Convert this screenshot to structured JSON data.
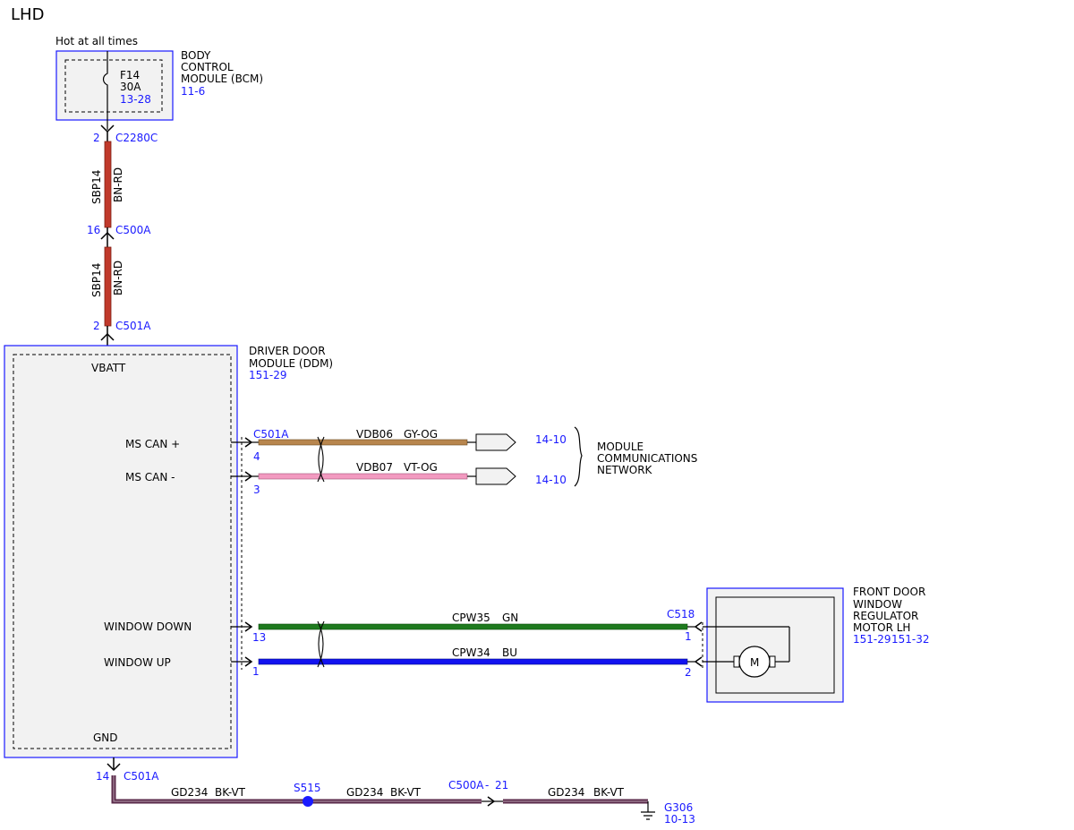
{
  "page": {
    "title": "LHD"
  },
  "bcm": {
    "feed_label": "Hot at all times",
    "name_line1": "BODY",
    "name_line2": "CONTROL",
    "name_line3": "MODULE (BCM)",
    "ref": "11-6",
    "fuse_name": "F14",
    "fuse_rating": "30A",
    "fuse_ref": "13-28"
  },
  "power_feed": {
    "conn1_pin": "2",
    "conn1_name": "C2280C",
    "seg1_circuit": "SBP14",
    "seg1_color": "BN-RD",
    "conn2_pin": "16",
    "conn2_name": "C500A",
    "seg2_circuit": "SBP14",
    "seg2_color": "BN-RD",
    "conn3_pin": "2",
    "conn3_name": "C501A"
  },
  "ddm": {
    "name_line1": "DRIVER DOOR",
    "name_line2": "MODULE (DDM)",
    "ref": "151-29",
    "vbatt": "VBATT",
    "gnd": "GND",
    "ms_can_plus": "MS CAN +",
    "ms_can_minus": "MS CAN -",
    "window_down": "WINDOW DOWN",
    "window_up": "WINDOW UP"
  },
  "can": {
    "connector": "C501A",
    "plus_pin": "4",
    "plus_circuit": "VDB06",
    "plus_color": "GY-OG",
    "plus_ref": "14-10",
    "minus_pin": "3",
    "minus_circuit": "VDB07",
    "minus_color": "VT-OG",
    "minus_ref": "14-10",
    "network_line1": "MODULE",
    "network_line2": "COMMUNICATIONS",
    "network_line3": "NETWORK"
  },
  "window": {
    "down_pin": "13",
    "down_circuit": "CPW35",
    "down_color": "GN",
    "up_pin": "1",
    "up_circuit": "CPW34",
    "up_color": "BU",
    "motor_connector": "C518",
    "motor_pin_down": "1",
    "motor_pin_up": "2",
    "motor_symbol": "M"
  },
  "motor": {
    "name_line1": "FRONT DOOR",
    "name_line2": "WINDOW",
    "name_line3": "REGULATOR",
    "name_line4": "MOTOR LH",
    "ref1": "151-29",
    "ref2": "151-32"
  },
  "ground": {
    "pin": "14",
    "connector": "C501A",
    "seg1_circuit": "GD234",
    "seg1_color": "BK-VT",
    "splice": "S515",
    "seg2_circuit": "GD234",
    "seg2_color": "BK-VT",
    "inline_connector": "C500A",
    "inline_sep": "-",
    "inline_pin": "21",
    "seg3_circuit": "GD234",
    "seg3_color": "BK-VT",
    "ground_name": "G306",
    "ground_ref": "10-13"
  },
  "colors": {
    "module_outline": "#1a1aff",
    "pin_text": "#1a1aff",
    "bn_rd": "#c0392b",
    "gy_og": "#b8864e",
    "vt_og": "#f29ac0",
    "gn": "#1e7a1e",
    "bu": "#1212f0",
    "bk_vt": "#5a2a4a"
  }
}
